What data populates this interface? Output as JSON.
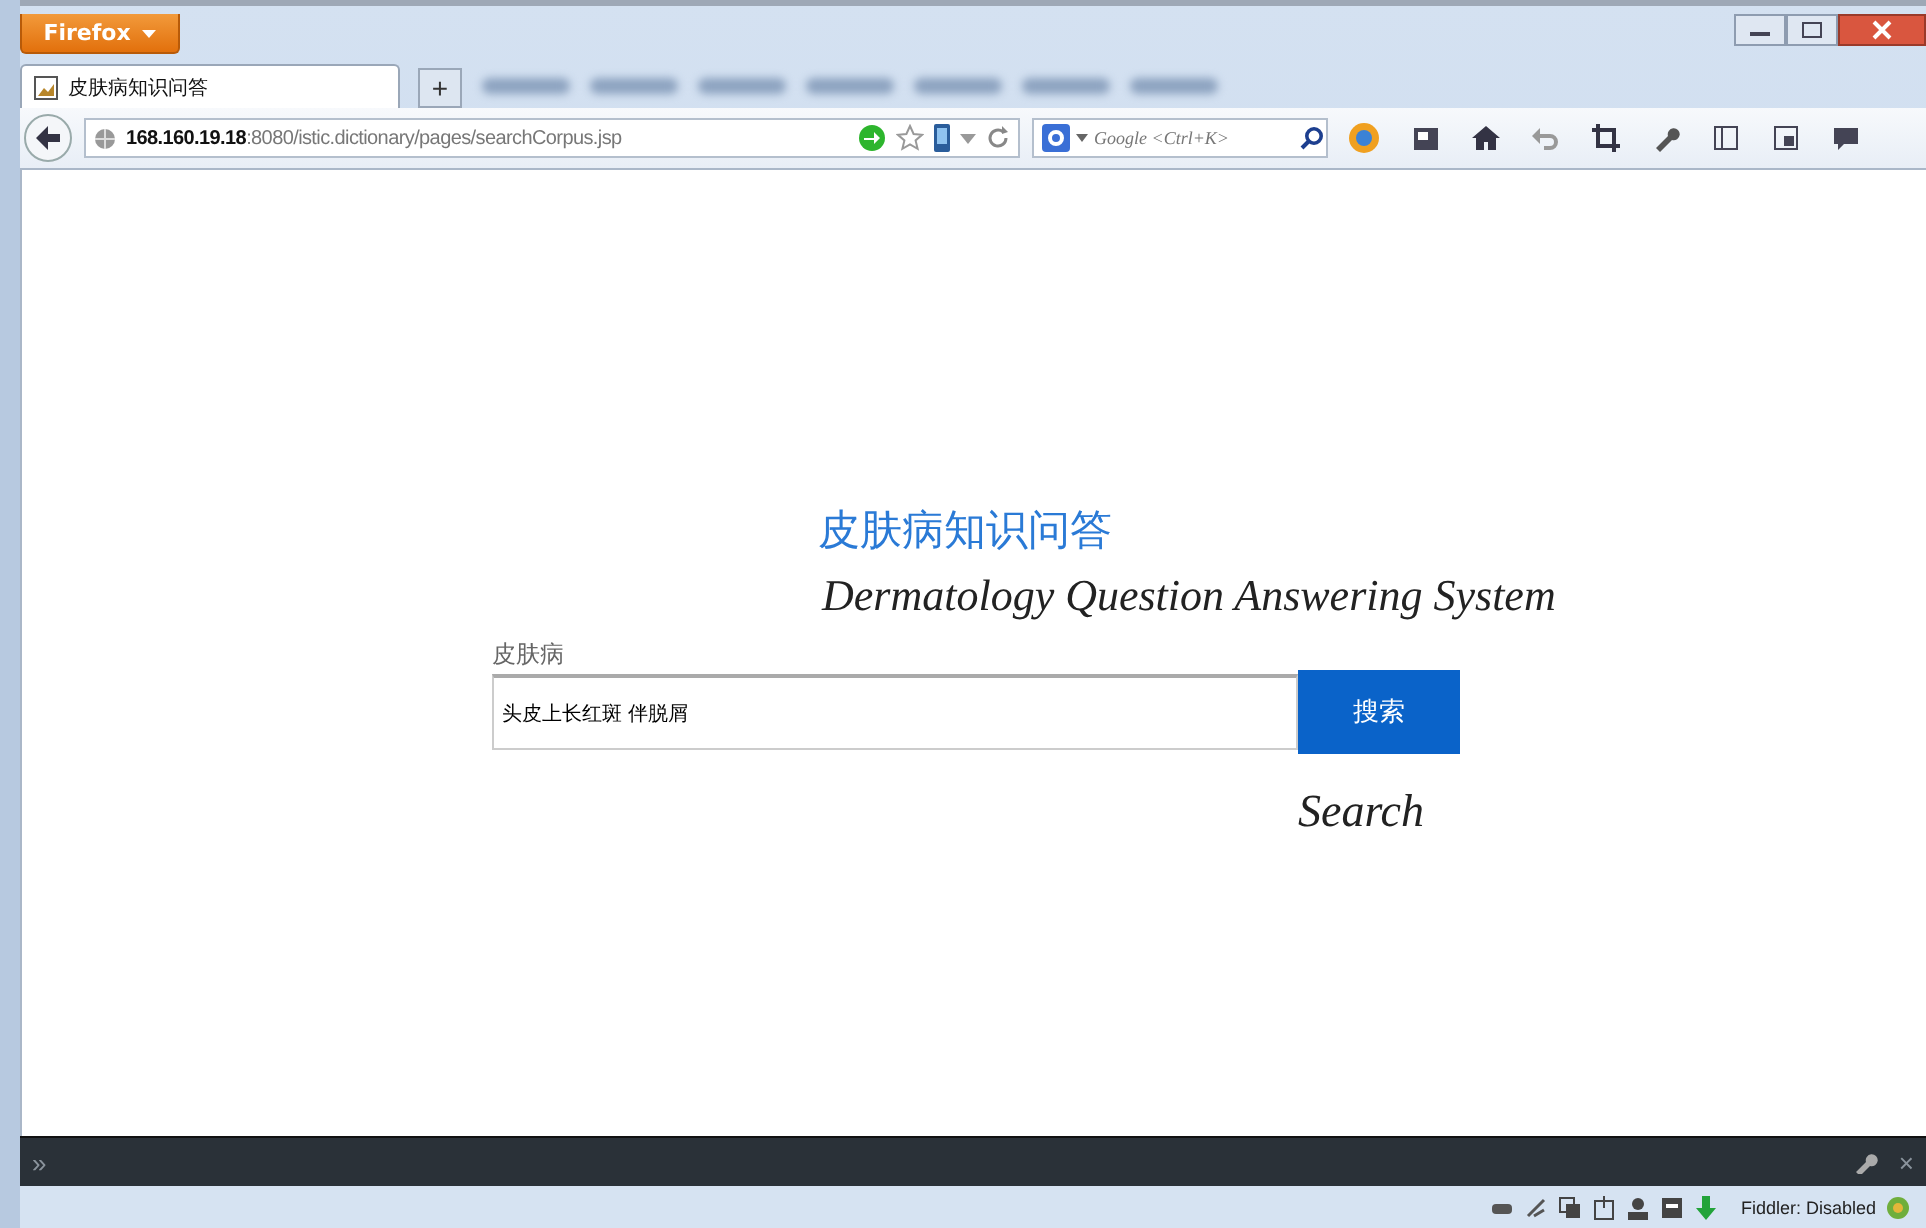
{
  "window": {
    "app_button": "Firefox"
  },
  "tabs": [
    {
      "label": "皮肤病知识问答",
      "selected": true
    }
  ],
  "new_tab": "+",
  "address_bar": {
    "host": "168.160.19.18",
    "path": ":8080/istic.dictionary/pages/searchCorpus.jsp"
  },
  "search_bar": {
    "placeholder": "Google <Ctrl+K>"
  },
  "page": {
    "title": "皮肤病知识问答",
    "subtitle": "Dermatology Question Answering System",
    "field_label": "皮肤病",
    "query": "头皮上长红斑 伴脱屑",
    "button": "搜索",
    "caption": "Search"
  },
  "dev_toolbar": {
    "expand": "»",
    "close": "×"
  },
  "status_bar": {
    "fiddler": "Fiddler: Disabled"
  }
}
